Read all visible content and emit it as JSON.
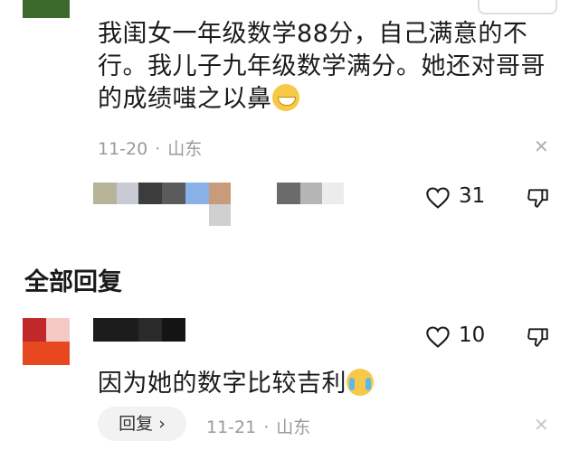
{
  "comment": {
    "text": "我闺女一年级数学88分，自己满意的不行。我儿子九年级数学满分。她还对哥哥的成绩嗤之以鼻",
    "emoji": "grinning-face-icon",
    "date": "11-20",
    "location": "山东",
    "like_count": "31"
  },
  "replies_section": {
    "title": "全部回复"
  },
  "reply": {
    "text": "因为她的数字比较吉利",
    "emoji": "crying-laughing-icon",
    "like_count": "10",
    "reply_button_label": "回复",
    "date": "11-21",
    "location": "山东"
  },
  "colors": {
    "text": "#1a1a1a",
    "meta": "#9a9a9a",
    "reply_button_bg": "#f2f2f2"
  }
}
